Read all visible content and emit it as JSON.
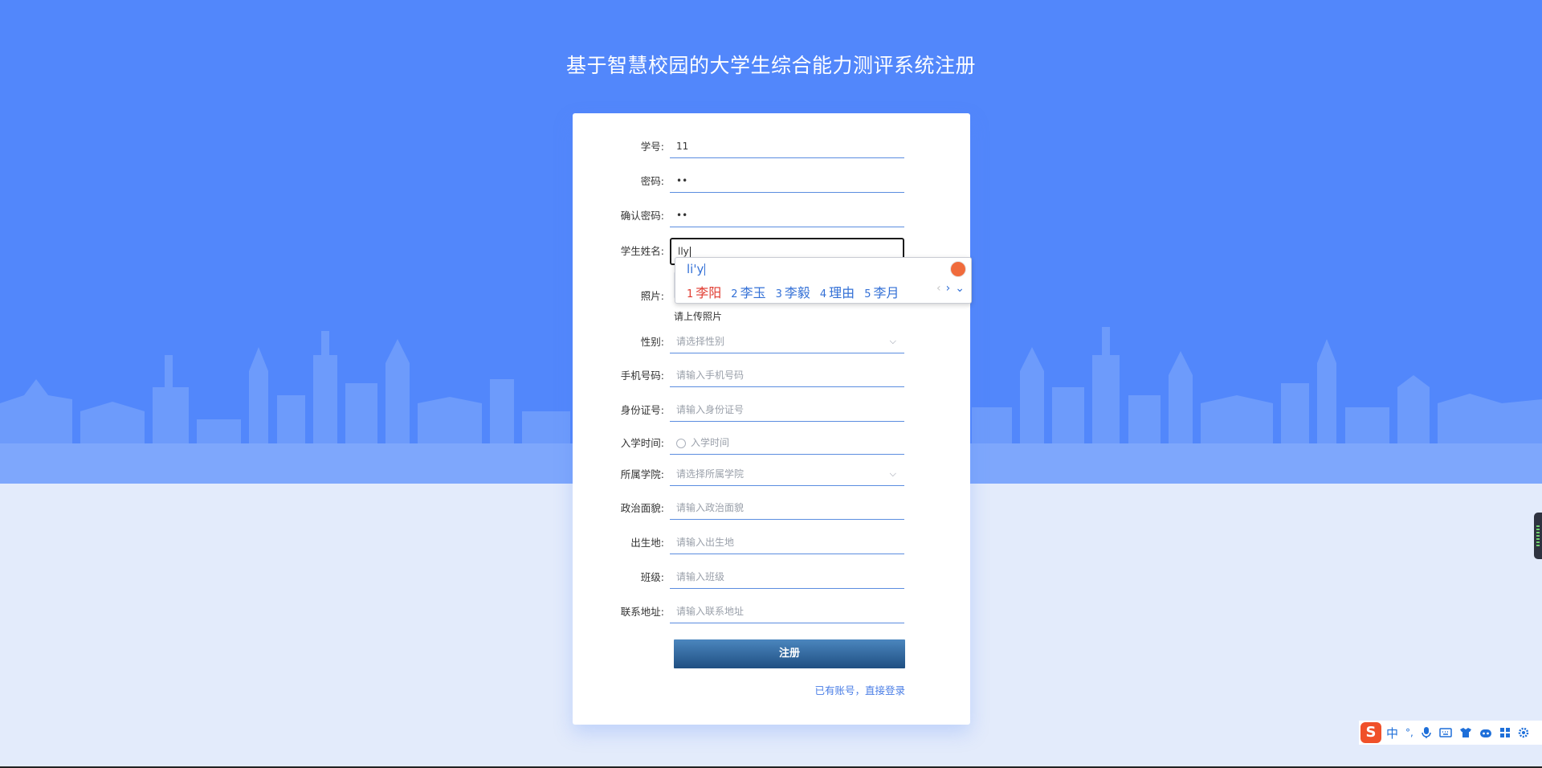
{
  "page": {
    "title": "基于智慧校园的大学生综合能力测评系统注册"
  },
  "form": {
    "student_id": {
      "label": "学号:",
      "value": "11"
    },
    "password": {
      "label": "密码:",
      "value": "••"
    },
    "confirm_password": {
      "label": "确认密码:",
      "value": "••"
    },
    "student_name": {
      "label": "学生姓名:",
      "value": "lly"
    },
    "photo": {
      "label": "照片:",
      "hint": "请上传照片"
    },
    "gender": {
      "label": "性别:",
      "placeholder": "请选择性别"
    },
    "phone": {
      "label": "手机号码:",
      "placeholder": "请输入手机号码"
    },
    "id_card": {
      "label": "身份证号:",
      "placeholder": "请输入身份证号"
    },
    "enroll_time": {
      "label": "入学时间:",
      "placeholder": "入学时间"
    },
    "college": {
      "label": "所属学院:",
      "placeholder": "请选择所属学院"
    },
    "political_status": {
      "label": "政治面貌:",
      "placeholder": "请输入政治面貌"
    },
    "birthplace": {
      "label": "出生地:",
      "placeholder": "请输入出生地"
    },
    "class": {
      "label": "班级:",
      "placeholder": "请输入班级"
    },
    "address": {
      "label": "联系地址:",
      "placeholder": "请输入联系地址"
    },
    "register_label": "注册",
    "login_link": "已有账号，直接登录"
  },
  "ime": {
    "composition": "li'y",
    "candidates": [
      {
        "num": "1",
        "text": "李阳"
      },
      {
        "num": "2",
        "text": "李玉"
      },
      {
        "num": "3",
        "text": "李毅"
      },
      {
        "num": "4",
        "text": "理由"
      },
      {
        "num": "5",
        "text": "李月"
      }
    ],
    "prev_arrow": "‹",
    "next_arrow": "›",
    "expand": "⌄"
  },
  "tray": {
    "logo": "S",
    "mode": "中",
    "punct": "°,",
    "icons": [
      "microphone-icon",
      "keyboard-icon",
      "skin-icon",
      "robot-icon",
      "apps-grid-icon",
      "settings-icon"
    ]
  },
  "colors": {
    "sky": "#5287fb",
    "ground": "#e3ebfb",
    "button_top": "#4b86be",
    "button_bottom": "#1f4f82",
    "link": "#4a7ee6",
    "ime_highlight": "#e03a2f"
  }
}
